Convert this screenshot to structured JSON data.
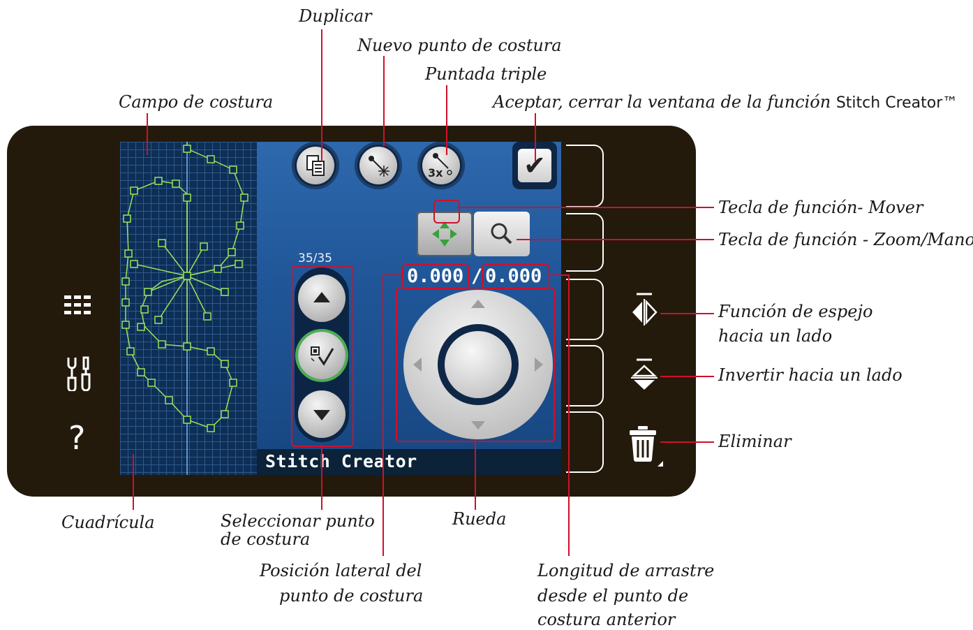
{
  "callouts": {
    "duplicar": "Duplicar",
    "nuevo_punto": "Nuevo punto de costura",
    "puntada_triple": "Puntada triple",
    "campo": "Campo de costura",
    "aceptar": "Aceptar, cerrar la ventana de la función",
    "aceptar_app": "Stitch Creator™",
    "mover": "Tecla de función- Mover",
    "zoom": "Tecla de función - Zoom/Mano",
    "espejo_1": "Función de espejo",
    "espejo_2": "hacia un lado",
    "invertir": "Invertir hacia un lado",
    "eliminar": "Eliminar",
    "cuadricula": "Cuadrícula",
    "seleccionar_1": "Seleccionar punto",
    "seleccionar_2": "de costura",
    "rueda": "Rueda",
    "posicion_1": "Posición lateral del",
    "posicion_2": "punto de costura",
    "longitud_1": "Longitud de arrastre",
    "longitud_2": "desde el punto de",
    "longitud_3": "costura anterior"
  },
  "screen": {
    "counter": "35/35",
    "x_value": "0.000",
    "separator": "/",
    "y_value": "0.000",
    "title": "Stitch Creator"
  },
  "sidebar": {
    "menu_icon": "list-menu-icon",
    "settings_icon": "tools-icon",
    "help_label": "?"
  },
  "colors": {
    "frame": "#231a0c",
    "screen_bg": "#1d4f8e",
    "leader": "#d0102a",
    "stitch": "#9be35a",
    "selected_ring": "#4caf50"
  }
}
